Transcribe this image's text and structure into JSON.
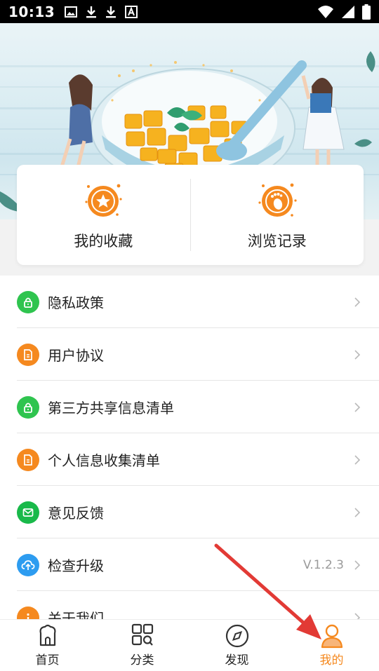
{
  "status_bar": {
    "time": "10:13",
    "icons": [
      "image-icon",
      "download-icon",
      "download-icon",
      "a-icon"
    ],
    "right_icons": [
      "wifi-icon",
      "signal-icon",
      "battery-icon"
    ]
  },
  "quick_actions": [
    {
      "label": "我的收藏",
      "icon": "star-icon",
      "color": "#f5891f"
    },
    {
      "label": "浏览记录",
      "icon": "footprint-icon",
      "color": "#f5891f"
    }
  ],
  "menu": [
    {
      "label": "隐私政策",
      "icon": "lock-icon",
      "color": "#2fc44f",
      "value": ""
    },
    {
      "label": "用户协议",
      "icon": "document-icon",
      "color": "#f5891f",
      "value": ""
    },
    {
      "label": "第三方共享信息清单",
      "icon": "lock-icon",
      "color": "#2fc44f",
      "value": ""
    },
    {
      "label": "个人信息收集清单",
      "icon": "document-icon",
      "color": "#f5891f",
      "value": ""
    },
    {
      "label": "意见反馈",
      "icon": "message-icon",
      "color": "#19b94a",
      "value": ""
    },
    {
      "label": "检查升级",
      "icon": "cloud-upload-icon",
      "color": "#2d9cf0",
      "value": "V.1.2.3"
    },
    {
      "label": "关于我们",
      "icon": "info-icon",
      "color": "#f5891f",
      "value": ""
    }
  ],
  "bottom_nav": [
    {
      "label": "首页",
      "icon": "home-icon",
      "active": false
    },
    {
      "label": "分类",
      "icon": "category-icon",
      "active": false
    },
    {
      "label": "发现",
      "icon": "compass-icon",
      "active": false
    },
    {
      "label": "我的",
      "icon": "profile-icon",
      "active": true
    }
  ],
  "colors": {
    "accent": "#f5891f",
    "green": "#2fc44f",
    "blue": "#2d9cf0",
    "arrow": "#e23a35"
  }
}
